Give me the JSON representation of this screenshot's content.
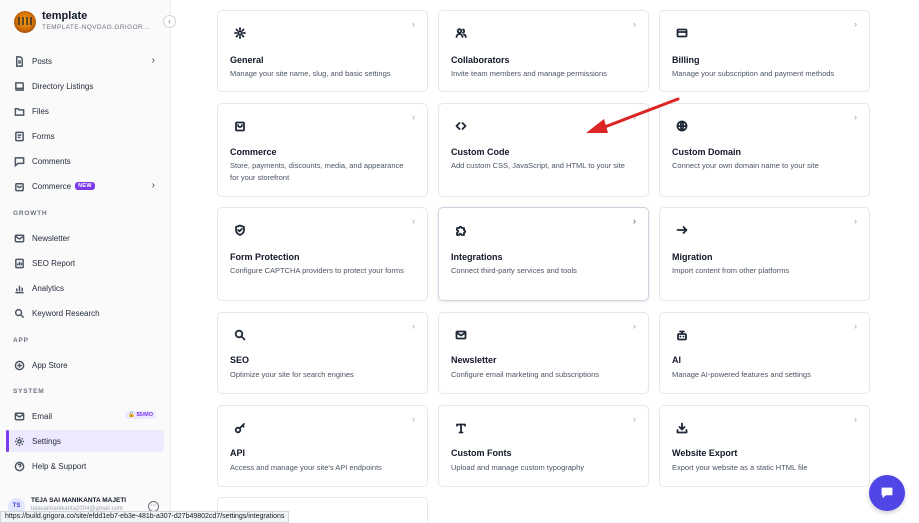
{
  "workspace": {
    "name": "template",
    "subtitle": "TEMPLATE-NQVDAG.GRIGOR...",
    "caret": "⌄",
    "collapse": "‹"
  },
  "nav": [
    {
      "label": "Posts",
      "icon": "document-icon",
      "chevron": "›"
    },
    {
      "label": "Directory Listings",
      "icon": "book-icon"
    },
    {
      "label": "Files",
      "icon": "folder-icon"
    },
    {
      "label": "Forms",
      "icon": "form-icon"
    },
    {
      "label": "Comments",
      "icon": "comment-icon"
    },
    {
      "label": "Commerce",
      "icon": "shopping-bag-icon",
      "badge": "NEW",
      "chevron": "›"
    }
  ],
  "sections": {
    "growth": "GROWTH",
    "app": "APP",
    "system": "SYSTEM"
  },
  "growth_nav": [
    {
      "label": "Newsletter",
      "icon": "mail-icon"
    },
    {
      "label": "SEO Report",
      "icon": "report-icon"
    },
    {
      "label": "Analytics",
      "icon": "chart-icon"
    },
    {
      "label": "Keyword Research",
      "icon": "search-icon"
    }
  ],
  "app_nav": [
    {
      "label": "App Store",
      "icon": "app-store-icon"
    }
  ],
  "system_nav": [
    {
      "label": "Email",
      "icon": "mail-icon",
      "badge": "$5/MO"
    },
    {
      "label": "Settings",
      "icon": "gear-icon",
      "active": true
    },
    {
      "label": "Help & Support",
      "icon": "help-icon"
    }
  ],
  "user": {
    "initials": "TS",
    "name": "TEJA SAI MANIKANTA MAJETI",
    "email": "tejasaimanikanta2004@gmail.com",
    "more": "⋯"
  },
  "cards": [
    {
      "title": "General",
      "desc": "Manage your site name, slug, and basic settings",
      "icon": "gear-icon"
    },
    {
      "title": "Collaborators",
      "desc": "Invite team members and manage permissions",
      "icon": "users-icon"
    },
    {
      "title": "Billing",
      "desc": "Manage your subscription and payment methods",
      "icon": "credit-card-icon"
    },
    {
      "title": "Commerce",
      "desc": "Store, payments, discounts, media, and appearance for your storefront",
      "icon": "shopping-bag-icon"
    },
    {
      "title": "Custom Code",
      "desc": "Add custom CSS, JavaScript, and HTML to your site",
      "icon": "code-icon"
    },
    {
      "title": "Custom Domain",
      "desc": "Connect your own domain name to your site",
      "icon": "globe-icon"
    },
    {
      "title": "Form Protection",
      "desc": "Configure CAPTCHA providers to protect your forms",
      "icon": "shield-check-icon"
    },
    {
      "title": "Integrations",
      "desc": "Connect third-party services and tools",
      "icon": "puzzle-icon"
    },
    {
      "title": "Migration",
      "desc": "Import content from other platforms",
      "icon": "arrow-right-icon"
    },
    {
      "title": "SEO",
      "desc": "Optimize your site for search engines",
      "icon": "search-icon"
    },
    {
      "title": "Newsletter",
      "desc": "Configure email marketing and subscriptions",
      "icon": "mail-icon"
    },
    {
      "title": "AI",
      "desc": "Manage AI-powered features and settings",
      "icon": "robot-icon"
    },
    {
      "title": "API",
      "desc": "Access and manage your site's API endpoints",
      "icon": "key-icon"
    },
    {
      "title": "Custom Fonts",
      "desc": "Upload and manage custom typography",
      "icon": "type-icon"
    },
    {
      "title": "Website Export",
      "desc": "Export your website as a static HTML file",
      "icon": "download-icon"
    }
  ],
  "card_arrow": "›",
  "status_url": "https://build.grigora.co/site/efdd1eb7-eb3e-481b-a307-d27b49802cd7/settings/integrations",
  "colors": {
    "accent": "#7c3aed",
    "chat": "#4f46e5",
    "annotation_arrow": "#dc2626"
  }
}
